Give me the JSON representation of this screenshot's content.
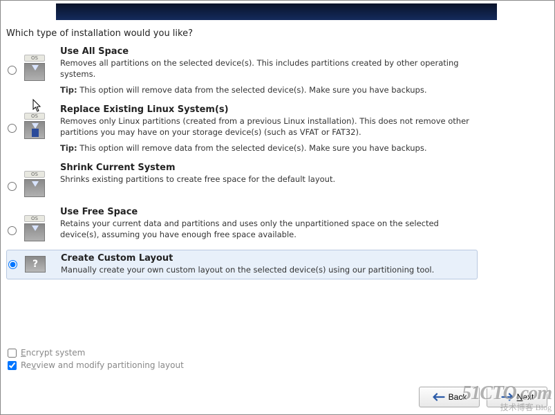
{
  "question": "Which type of installation would you like?",
  "options": {
    "use_all_space": {
      "title": "Use All Space",
      "desc": "Removes all partitions on the selected device(s).  This includes partitions created by other operating systems.",
      "tip_label": "Tip:",
      "tip_text": " This option will remove data from the selected device(s).  Make sure you have backups."
    },
    "replace_existing": {
      "title": "Replace Existing Linux System(s)",
      "desc": "Removes only Linux partitions (created from a previous Linux installation).  This does not remove other partitions you may have on your storage device(s) (such as VFAT or FAT32).",
      "tip_label": "Tip:",
      "tip_text": " This option will remove data from the selected device(s).  Make sure you have backups."
    },
    "shrink": {
      "title": "Shrink Current System",
      "desc": "Shrinks existing partitions to create free space for the default layout."
    },
    "use_free": {
      "title": "Use Free Space",
      "desc": "Retains your current data and partitions and uses only the unpartitioned space on the selected device(s), assuming you have enough free space available."
    },
    "custom": {
      "title": "Create Custom Layout",
      "desc": "Manually create your own custom layout on the selected device(s) using our partitioning tool."
    }
  },
  "icon_os_label": "OS",
  "question_mark": "?",
  "checks": {
    "encrypt": "ncrypt system",
    "encrypt_prefix": "E",
    "review": "view and modify partitioning layout",
    "review_prefix": "Re"
  },
  "buttons": {
    "back": "Back",
    "back_prefix": "",
    "next": "Next"
  },
  "watermark": {
    "big": "51CTO.com",
    "small": "技术博客  Blog"
  }
}
